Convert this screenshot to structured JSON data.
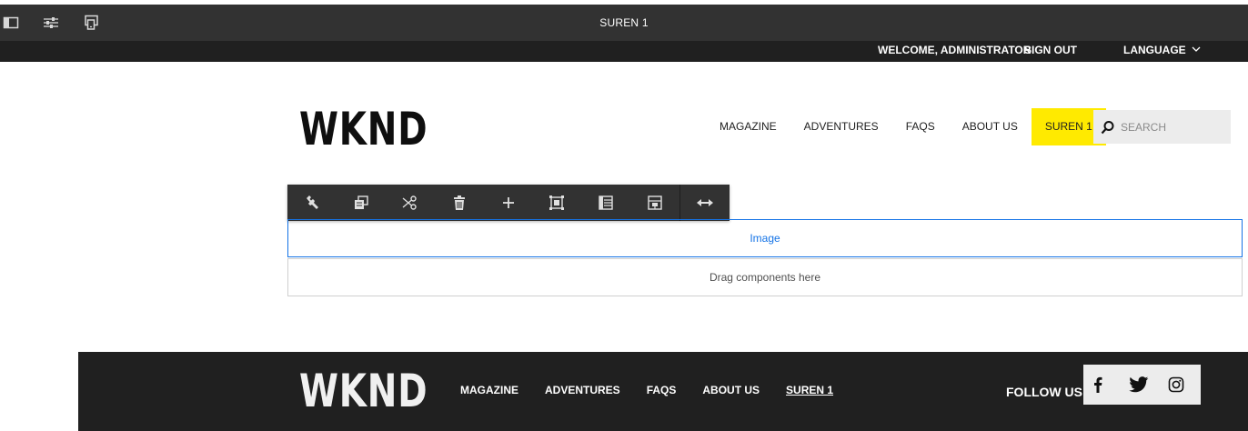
{
  "editor": {
    "page_title": "SUREN 1",
    "icons": [
      "side-panel-icon",
      "page-properties-icon",
      "emulator-icon"
    ]
  },
  "userbar": {
    "welcome": "WELCOME, ADMINISTRATOR",
    "sign_out": "SIGN OUT",
    "language": "LANGUAGE"
  },
  "header": {
    "logo": "WKND",
    "nav": [
      "MAGAZINE",
      "ADVENTURES",
      "FAQS",
      "ABOUT US",
      "SUREN 1"
    ],
    "active_nav": "SUREN 1",
    "search_placeholder": "SEARCH"
  },
  "component_toolbar": {
    "actions": [
      "configure",
      "copy",
      "cut",
      "delete",
      "insert",
      "group",
      "layout",
      "parent",
      "resize"
    ]
  },
  "content": {
    "image_label": "Image",
    "drop_label": "Drag components here"
  },
  "footer": {
    "logo": "WKND",
    "nav": [
      "MAGAZINE",
      "ADVENTURES",
      "FAQS",
      "ABOUT US",
      "SUREN 1"
    ],
    "active_nav": "SUREN 1",
    "follow_label": "FOLLOW US",
    "social": [
      "facebook-icon",
      "twitter-icon",
      "instagram-icon"
    ]
  },
  "colors": {
    "accent_yellow": "#ffea00",
    "editor_dark": "#323232",
    "selection_blue": "#1473e6",
    "footer_bg": "#202020"
  }
}
